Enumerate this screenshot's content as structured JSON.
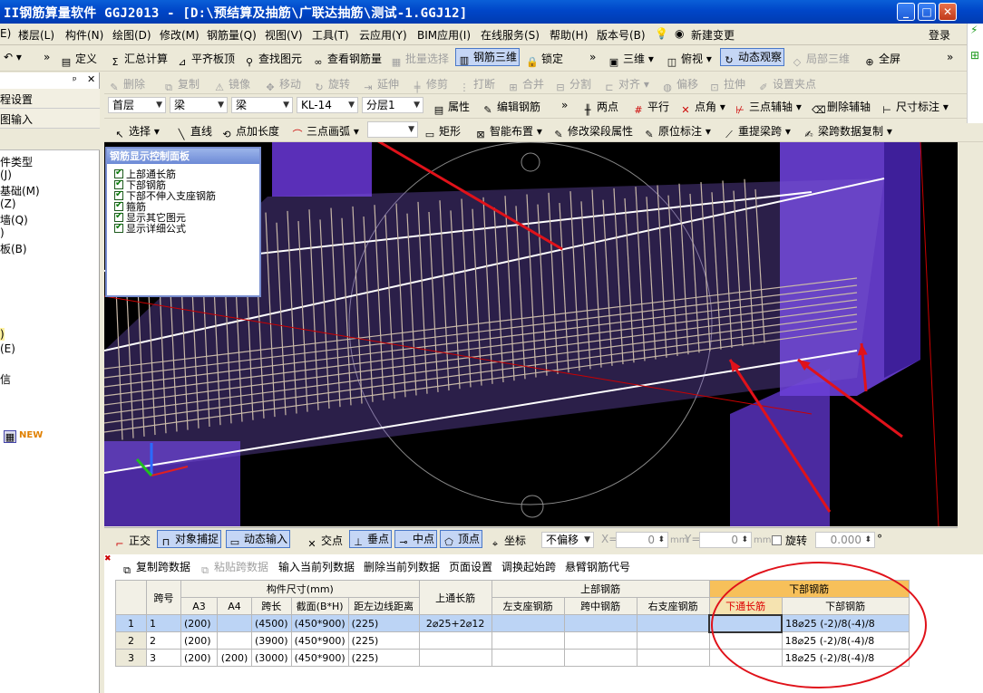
{
  "window": {
    "title": "II钢筋算量软件 GGJ2013 - [D:\\预结算及抽筋\\广联达抽筋\\测试-1.GGJ12]",
    "btn_min": "_",
    "btn_max": "□",
    "btn_close": "✕"
  },
  "menu": {
    "items": [
      "E)",
      "楼层(L)",
      "构件(N)",
      "绘图(D)",
      "修改(M)",
      "钢筋量(Q)",
      "视图(V)",
      "工具(T)",
      "云应用(Y)",
      "BIM应用(I)",
      "在线服务(S)",
      "帮助(H)",
      "版本号(B)",
      "新建变更"
    ],
    "login": "登录"
  },
  "toolbar1": {
    "define": "定义",
    "sum_calc": "汇总计算",
    "align_slab": "平齐板顶",
    "find_elem": "查找图元",
    "view_rebar": "查看钢筋量",
    "batch_select": "批量选择",
    "rebar_3d": "钢筋三维",
    "lock": "锁定",
    "three_d": "三维",
    "top_view": "俯视",
    "dynamic_view": "动态观察",
    "local_3d": "局部三维",
    "fullscreen": "全屏"
  },
  "toolbar2": {
    "delete": "删除",
    "copy": "复制",
    "mirror": "镜像",
    "move": "移动",
    "rotate": "旋转",
    "extend": "延伸",
    "trim": "修剪",
    "break": "打断",
    "merge": "合并",
    "split": "分割",
    "align": "对齐",
    "offset": "偏移",
    "stretch": "拉伸",
    "set_grip": "设置夹点"
  },
  "toolbar3": {
    "floor": "首层",
    "category": "梁",
    "type": "梁",
    "element": "KL-14",
    "layer": "分层1",
    "property": "属性",
    "edit_rebar": "编辑钢筋",
    "two_points": "两点",
    "parallel": "平行",
    "point_angle": "点角",
    "three_aux": "三点辅轴",
    "del_aux": "删除辅轴",
    "dimension": "尺寸标注"
  },
  "toolbar4": {
    "select": "选择",
    "line": "直线",
    "point_length": "点加长度",
    "arc": "三点画弧",
    "rect": "矩形",
    "smart_place": "智能布置",
    "edit_span": "修改梁段属性",
    "orig_mark": "原位标注",
    "reextract": "重提梁跨",
    "copy_span": "梁跨数据复制"
  },
  "left_panel": {
    "pin": "ᵖ",
    "close": "✕",
    "items": [
      "程设置",
      "图输入",
      "件类型",
      "(J)",
      "基础(M)",
      "(Z)",
      "墙(Q)",
      ")",
      "板(B)",
      ")",
      "(E)",
      "信",
      "NEW"
    ]
  },
  "control_panel": {
    "title": "钢筋显示控制面板",
    "items": [
      "上部通长筋",
      "下部钢筋",
      "下部不伸入支座钢筋",
      "箍筋",
      "显示其它图元",
      "显示详细公式"
    ]
  },
  "snap_bar": {
    "ortho": "正交",
    "obj_snap": "对象捕捉",
    "dyn_input": "动态输入",
    "intersect": "交点",
    "perp": "垂点",
    "mid": "中点",
    "vertex": "顶点",
    "coord": "坐标",
    "offset_mode": "不偏移",
    "x_label": "X=",
    "x_value": "0",
    "y_label": "Y=",
    "y_value": "0",
    "unit": "mm",
    "rotate_label": "旋转",
    "rotate_value": "0.000",
    "deg": "°"
  },
  "table_tools": [
    "复制跨数据",
    "粘贴跨数据",
    "输入当前列数据",
    "删除当前列数据",
    "页面设置",
    "调换起始跨",
    "悬臂钢筋代号"
  ],
  "table": {
    "h_span": "跨号",
    "h_dims": "构件尺寸(mm)",
    "h_upper_long": "上通长筋",
    "h_upper": "上部钢筋",
    "h_lower": "下部钢筋",
    "sub": [
      "A3",
      "A4",
      "跨长",
      "截面(B*H)",
      "距左边线距离"
    ],
    "sub_upper": [
      "左支座钢筋",
      "跨中钢筋",
      "右支座钢筋"
    ],
    "sub_lower": [
      "下通长筋",
      "下部钢筋"
    ],
    "rows": [
      {
        "idx": "1",
        "span": "1",
        "a3": "(200)",
        "a4": "",
        "len": "(4500)",
        "sec": "(450*900)",
        "dist": "(225)",
        "upper_long": "2⌀25+2⌀12",
        "left": "",
        "mid": "",
        "right": "",
        "lower_long": "",
        "lower": "18⌀25  (-2)/8(-4)/8"
      },
      {
        "idx": "2",
        "span": "2",
        "a3": "(200)",
        "a4": "",
        "len": "(3900)",
        "sec": "(450*900)",
        "dist": "(225)",
        "upper_long": "",
        "left": "",
        "mid": "",
        "right": "",
        "lower_long": "",
        "lower": "18⌀25  (-2)/8(-4)/8"
      },
      {
        "idx": "3",
        "span": "3",
        "a3": "(200)",
        "a4": "(200)",
        "len": "(3000)",
        "sec": "(450*900)",
        "dist": "(225)",
        "upper_long": "",
        "left": "",
        "mid": "",
        "right": "",
        "lower_long": "",
        "lower": "18⌀25  (-2)/8(-4)/8"
      }
    ]
  },
  "colors": {
    "accent_blue": "#0046c8",
    "annotation_red": "#e0121a",
    "purple": "#6a3fd6",
    "rebar": "#c8b8a8"
  }
}
